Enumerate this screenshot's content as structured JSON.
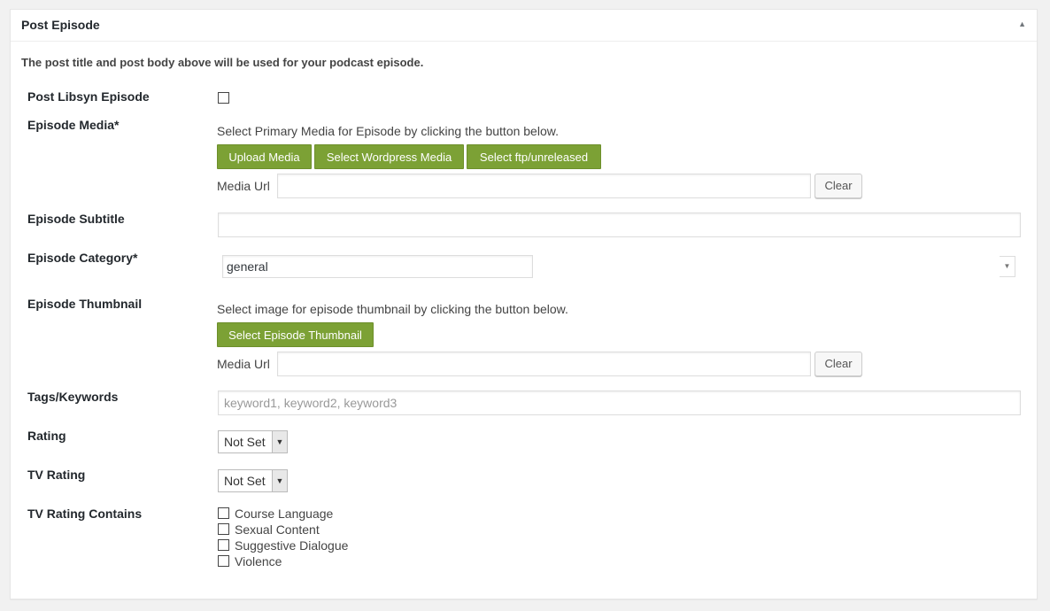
{
  "panel": {
    "title": "Post Episode",
    "toggle_icon": "triangle-up-icon",
    "intro": "The post title and post body above will be used for your podcast episode."
  },
  "labels": {
    "post_libsyn": "Post Libsyn Episode",
    "media": "Episode Media*",
    "subtitle": "Episode Subtitle",
    "category": "Episode Category*",
    "thumbnail": "Episode Thumbnail",
    "tags": "Tags/Keywords",
    "rating": "Rating",
    "tv_rating": "TV Rating",
    "tv_contains": "TV Rating Contains"
  },
  "media": {
    "instruction": "Select Primary Media for Episode by clicking the button below.",
    "upload_button": "Upload Media",
    "wordpress_button": "Select Wordpress Media",
    "ftp_button": "Select ftp/unreleased",
    "url_label": "Media Url",
    "url_value": "",
    "clear_button": "Clear"
  },
  "subtitle": {
    "value": ""
  },
  "category": {
    "value": "general"
  },
  "thumbnail": {
    "instruction": "Select image for episode thumbnail by clicking the button below.",
    "select_button": "Select Episode Thumbnail",
    "url_label": "Media Url",
    "url_value": "",
    "clear_button": "Clear"
  },
  "tags": {
    "placeholder": "keyword1, keyword2, keyword3",
    "value": ""
  },
  "rating": {
    "selected": "Not Set"
  },
  "tv_rating": {
    "selected": "Not Set"
  },
  "tv_contains": {
    "options": [
      "Course Language",
      "Sexual Content",
      "Suggestive Dialogue",
      "Violence"
    ]
  },
  "colors": {
    "accent_button": "#7ca135"
  }
}
